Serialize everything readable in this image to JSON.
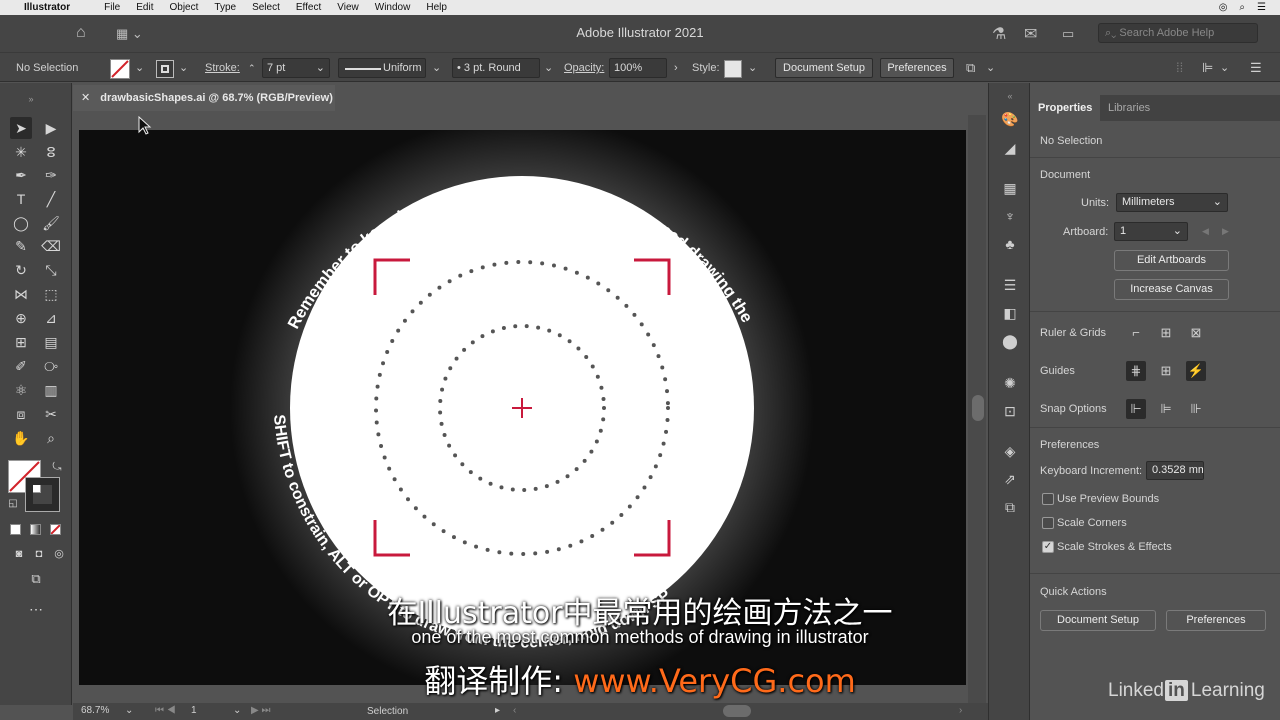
{
  "menubar": {
    "app": "Illustrator",
    "items": [
      "File",
      "Edit",
      "Object",
      "Type",
      "Select",
      "Effect",
      "View",
      "Window",
      "Help"
    ]
  },
  "titlebar": {
    "title": "Adobe Illustrator 2021",
    "search_placeholder": "Search Adobe Help"
  },
  "controlbar": {
    "selection": "No Selection",
    "stroke_label": "Stroke:",
    "stroke_weight": "7 pt",
    "stroke_profile": "Uniform",
    "brush": "3 pt. Round",
    "opacity_label": "Opacity:",
    "opacity_value": "100%",
    "style_label": "Style:",
    "document_setup": "Document Setup",
    "preferences": "Preferences"
  },
  "document": {
    "tab_title": "drawbasicShapes.ai @ 68.7% (RGB/Preview)",
    "zoom": "68.7%",
    "artboard_num": "1",
    "status_tool": "Selection"
  },
  "artwork": {
    "top_arc_text": "Remember to keep key(s) held down until you’ve stopped drawing the shape",
    "left_arc_text": "SHIFT to constrain, ALT or OPT to draw from the center, hold down SPACE to relocate shape while drawing",
    "accent": "#c8193c",
    "dot_color": "#555555"
  },
  "properties": {
    "tabs": [
      "Properties",
      "Libraries"
    ],
    "selection": "No Selection",
    "document_heading": "Document",
    "units_label": "Units:",
    "units_value": "Millimeters",
    "artboard_label": "Artboard:",
    "artboard_value": "1",
    "edit_artboards": "Edit Artboards",
    "increase_canvas": "Increase Canvas",
    "ruler_grids": "Ruler & Grids",
    "guides": "Guides",
    "snap_options": "Snap Options",
    "preferences_heading": "Preferences",
    "keyboard_increment_label": "Keyboard Increment:",
    "keyboard_increment_value": "0.3528 mm",
    "use_preview_bounds": "Use Preview Bounds",
    "scale_corners": "Scale Corners",
    "scale_strokes_effects": "Scale Strokes & Effects",
    "quick_actions": "Quick Actions",
    "qa_document_setup": "Document Setup",
    "qa_preferences": "Preferences"
  },
  "subtitles": {
    "zh": "在Illustrator中最常用的绘画方法之一",
    "en": "one of the most common methods of drawing in illustrator",
    "credit_prefix": "翻译制作: ",
    "credit_url": "www.VeryCG.com"
  },
  "watermark": {
    "linked": "Linked",
    "in": "in",
    "learning": "Learning"
  }
}
